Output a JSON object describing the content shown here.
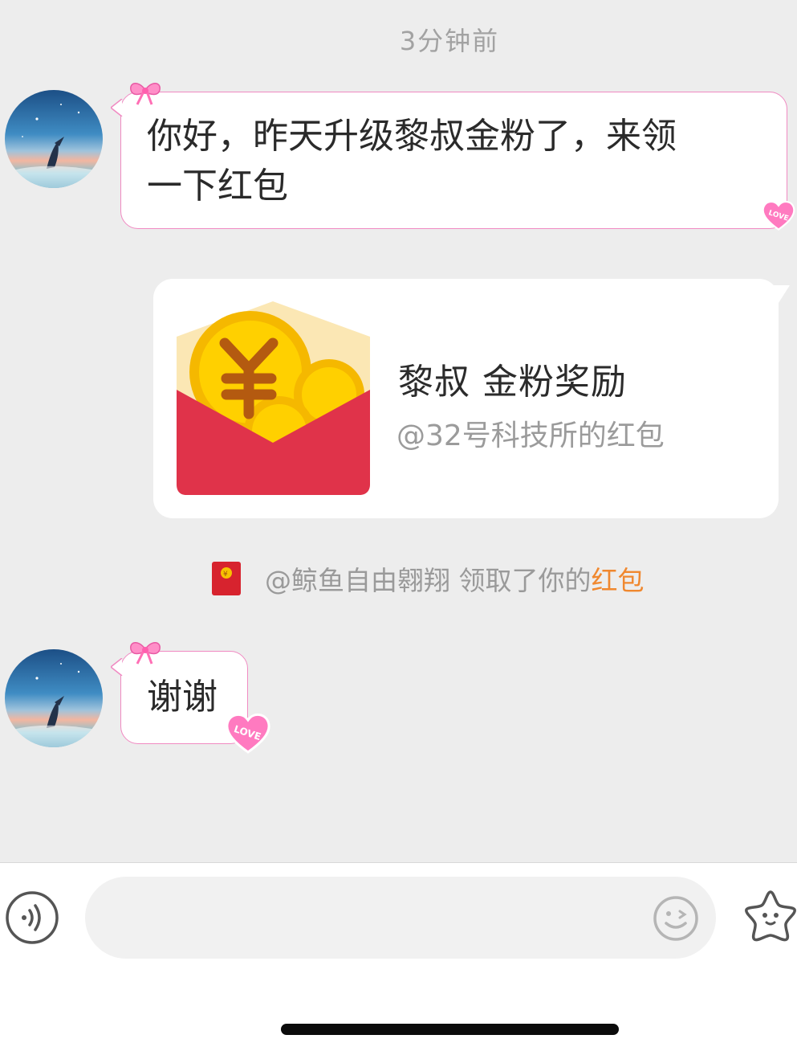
{
  "chat": {
    "timestamp": "3分钟前",
    "messages": [
      {
        "sender": "other",
        "text_line1": "你好，昨天升级黎叔金粉了，来领",
        "text_line2": "一下红包"
      },
      {
        "sender": "self",
        "type": "red-packet",
        "title": "黎叔 金粉奖励",
        "subtitle": "@32号科技所的红包"
      },
      {
        "type": "system",
        "prefix": "@鲸鱼自由翱翔 领取了你的",
        "link": "红包"
      },
      {
        "sender": "other",
        "text": "谢谢"
      }
    ]
  },
  "decorations": {
    "heart_badge_text": "LOVE",
    "bubble_border_color": "#f08ac2",
    "accent_color": "#f0882f",
    "packet_red": "#e0334a",
    "coin_gold": "#f8c000"
  },
  "input_bar": {
    "placeholder": "",
    "icons": [
      "voice-icon",
      "emoji-icon",
      "more-star-icon"
    ]
  }
}
